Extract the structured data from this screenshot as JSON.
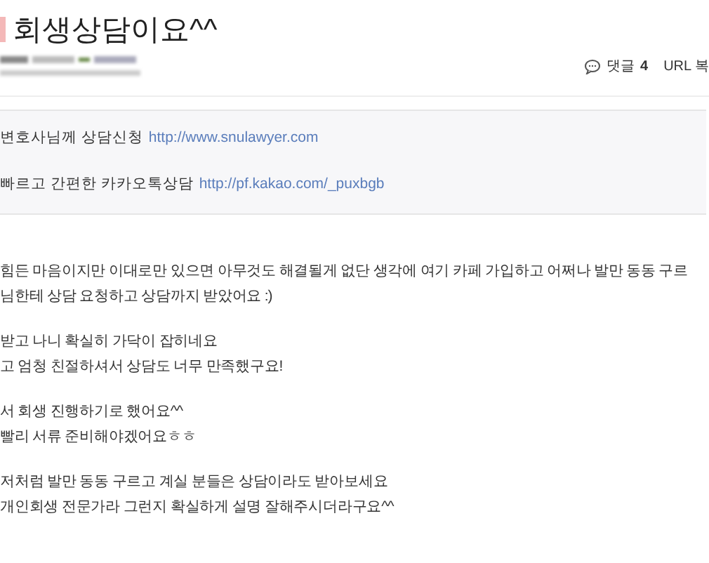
{
  "title": "회생상담이요^^",
  "meta": {
    "comments_label": "댓글",
    "comments_count": "4",
    "url_copy": "URL 복"
  },
  "link_box": [
    {
      "text": "변호사님께 상담신청",
      "url": "http://www.snulawyer.com"
    },
    {
      "text": "빠르고 간편한 카카오톡상담",
      "url": "http://pf.kakao.com/_puxbgb"
    }
  ],
  "paragraphs": [
    [
      "힘든 마음이지만 이대로만 있으면 아무것도 해결될게 없단 생각에 여기 카페 가입하고 어쩌나 발만 동동 구르",
      "님한테 상담 요청하고 상담까지 받았어요 :)"
    ],
    [
      "받고 나니 확실히 가닥이 잡히네요",
      "고 엄청 친절하셔서 상담도 너무 만족했구요!"
    ],
    [
      "서 회생 진행하기로 했어요^^",
      "빨리 서류 준비해야겠어요ㅎㅎ"
    ],
    [
      "저처럼 발만 동동 구르고 계실 분들은 상담이라도 받아보세요",
      "개인회생 전문가라 그런지 확실하게 설명 잘해주시더라구요^^"
    ]
  ]
}
